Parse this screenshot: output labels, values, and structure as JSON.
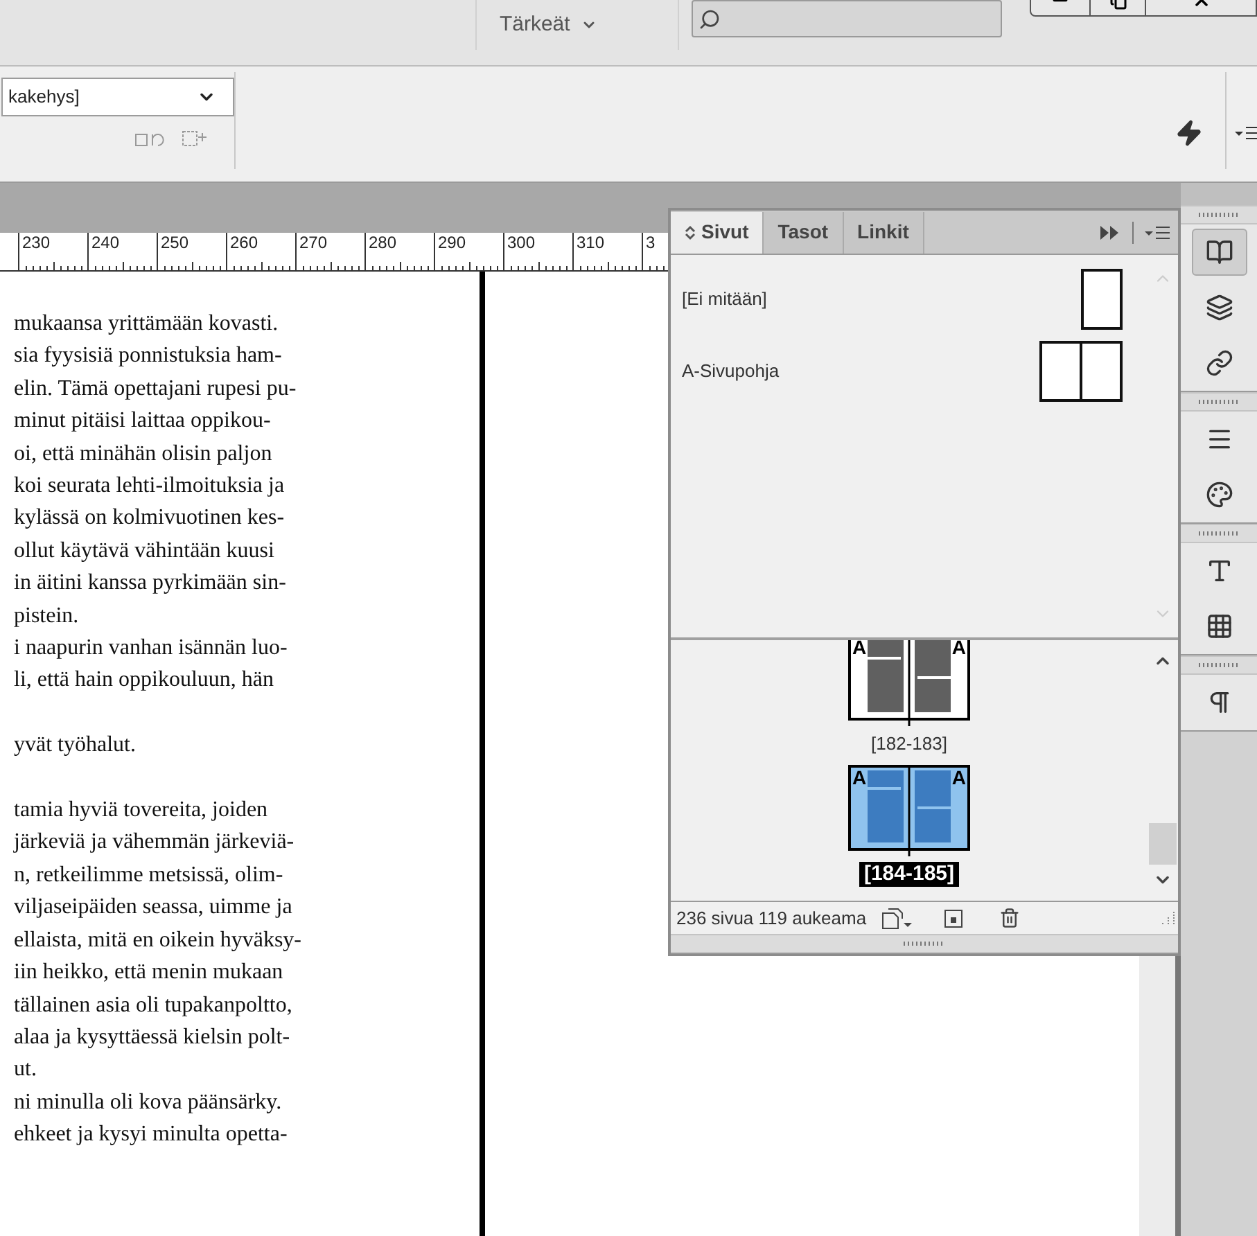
{
  "top_bar": {
    "workspace": "Tärkeät"
  },
  "toolbar": {
    "style_dropdown": "kakehys]"
  },
  "ruler": {
    "labels": [
      "230",
      "240",
      "250",
      "260",
      "270",
      "280",
      "290",
      "300",
      "310",
      "3"
    ]
  },
  "document": {
    "paragraphs": [
      {
        "lines": [
          "mukaansa yrittämään kovasti.",
          "sia fyysisiä ponnistuksia ham-",
          "elin. Tämä opettajani rupesi pu-",
          "minut pitäisi laittaa oppikou-",
          "oi, että minähän olisin paljon",
          "koi seurata lehti-ilmoituksia ja",
          "kylässä on kolmivuotinen kes-",
          "ollut käytävä vähintään kuusi",
          "in äitini kanssa pyrkimään sin-",
          "pistein.",
          "i naapurin vanhan isännän luo-",
          "li, että hain oppikouluun, hän"
        ]
      },
      {
        "lines": [
          "yvät työhalut."
        ]
      },
      {
        "lines": [
          "tamia hyviä tovereita, joiden",
          "järkeviä ja vähemmän järkeviä-",
          "n, retkeilimme metsissä, olim-",
          "viljaseipäiden seassa, uimme ja",
          "ellaista, mitä en oikein hyväksy-",
          "iin heikko, että menin mukaan",
          "tällainen asia oli tupakanpoltto,",
          "alaa ja kysyttäessä kielsin polt-",
          "ut.",
          "ni minulla oli kova päänsärky.",
          "ehkeet ja kysyi minulta opetta-"
        ]
      }
    ]
  },
  "pages_panel": {
    "tabs": [
      {
        "label": "Sivut",
        "selected": true
      },
      {
        "label": "Tasot",
        "selected": false
      },
      {
        "label": "Linkit",
        "selected": false
      }
    ],
    "masters": [
      {
        "name": "[Ei mitään]",
        "kind": "single"
      },
      {
        "name": "A-Sivupohja",
        "kind": "spread"
      }
    ],
    "spreads": [
      {
        "label": "[182-183]",
        "masters": [
          "A",
          "A"
        ],
        "selected": false
      },
      {
        "label": "[184-185]",
        "masters": [
          "A",
          "A"
        ],
        "selected": true
      }
    ],
    "status": "236 sivua 119 aukeama"
  },
  "dock": {
    "groups": [
      [
        {
          "kind": "pages",
          "selected": true
        },
        {
          "kind": "layers",
          "selected": false
        },
        {
          "kind": "links",
          "selected": false
        }
      ],
      [
        {
          "kind": "stroke",
          "selected": false
        },
        {
          "kind": "color",
          "selected": false
        }
      ],
      [
        {
          "kind": "character-styles",
          "selected": false
        },
        {
          "kind": "swatches",
          "selected": false
        }
      ],
      [
        {
          "kind": "paragraph-styles",
          "selected": false
        }
      ]
    ]
  }
}
